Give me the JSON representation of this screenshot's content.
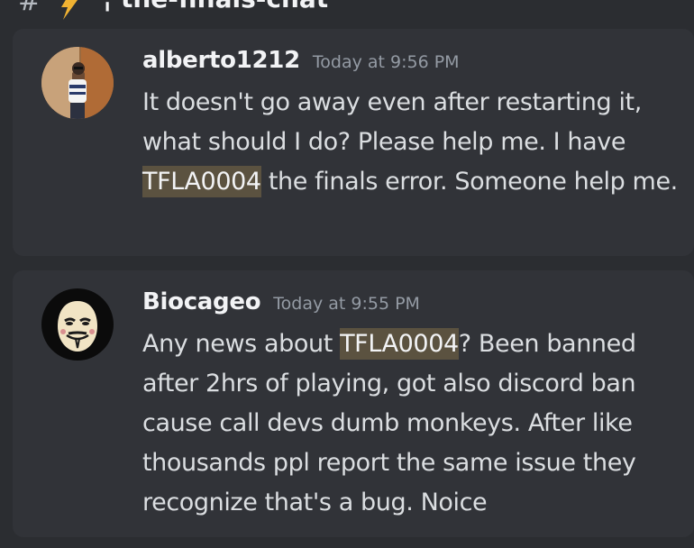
{
  "channel": {
    "hash_symbol": "#",
    "icon": "lightning-bolt-icon",
    "name": "¦ the-finals-chat"
  },
  "colors": {
    "background": "#2b2d31",
    "card": "#313338",
    "highlight": "#5b5240",
    "username": "#f2f3f5",
    "timestamp": "#949ba4",
    "text": "#dbdee1",
    "bolt": "#f0b232"
  },
  "messages": [
    {
      "username": "alberto1212",
      "timestamp": "Today at 9:56 PM",
      "avatar": "user-photo-avatar",
      "text_before": "It doesn't go away even after restarting it, what should I do? Please help me. I have ",
      "highlight": "TFLA0004",
      "text_after": " the finals error. Someone help me."
    },
    {
      "username": "Biocageo",
      "timestamp": "Today at 9:55 PM",
      "avatar": "guy-fawkes-mask-avatar",
      "text_before": "Any news about ",
      "highlight": "TFLA0004",
      "text_after": "? Been banned after 2hrs of playing, got also discord ban cause call devs dumb monkeys. After like thousands ppl report the same issue they recognize that's a bug. Noice"
    }
  ]
}
